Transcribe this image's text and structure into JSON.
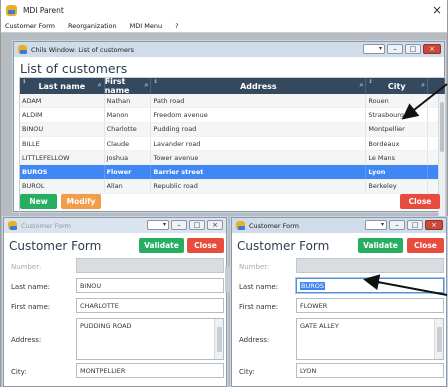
{
  "app": {
    "title": "MDI Parent",
    "close_glyph": "×"
  },
  "menu": [
    "Customer Form",
    "Reorganization",
    "MDI Menu",
    "?"
  ],
  "list_window": {
    "title": "Chils Window: List of customers",
    "heading": "List of customers",
    "columns": [
      "Last name",
      "First name",
      "Address",
      "City"
    ],
    "rows": [
      [
        "ADAM",
        "Nathan",
        "Path road",
        "Rouen"
      ],
      [
        "ALDIM",
        "Manon",
        "Freedom avenue",
        "Strasbourg"
      ],
      [
        "BINOU",
        "Charlotte",
        "Pudding road",
        "Montpellier"
      ],
      [
        "BILLE",
        "Claude",
        "Lavander road",
        "Bordeaux"
      ],
      [
        "LITTLEFELLOW",
        "Joshua",
        "Tower avenue",
        "Le Mans"
      ],
      [
        "BUROS",
        "Flower",
        "Barrier street",
        "Lyon"
      ],
      [
        "BUROL",
        "Allan",
        "Republic road",
        "Berkeley"
      ]
    ],
    "selected_row": 5,
    "new_label": "New",
    "modify_label": "Modify",
    "close_label": "Close"
  },
  "form_left": {
    "title": "Customer Form",
    "heading": "Customer Form",
    "validate_label": "Validate",
    "close_label": "Close",
    "number_label": "Number:",
    "last_name_label": "Last name:",
    "first_name_label": "First name:",
    "address_label": "Address:",
    "city_label": "City:",
    "last_name": "BINOU",
    "first_name": "CHARLOTTE",
    "address": "PUDDING ROAD",
    "city": "MONTPELLIER"
  },
  "form_right": {
    "title": "Customer Form",
    "heading": "Customer Form",
    "validate_label": "Validate",
    "close_label": "Close",
    "number_label": "Number:",
    "last_name_label": "Last name:",
    "first_name_label": "First name:",
    "address_label": "Address:",
    "city_label": "City:",
    "last_name": "BUROS",
    "first_name": "FLOWER",
    "address": "GATE ALLEY",
    "city": "LYON"
  }
}
